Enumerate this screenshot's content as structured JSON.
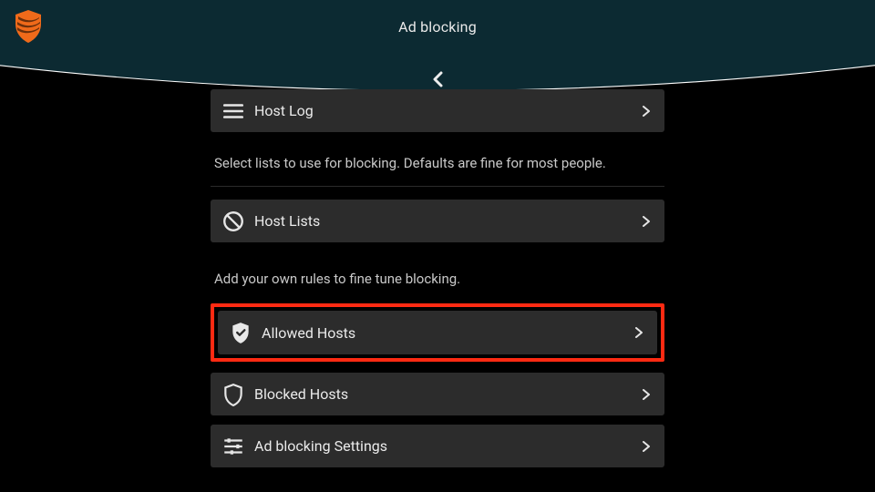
{
  "header": {
    "title": "Ad blocking"
  },
  "items": {
    "host_log": "Host Log",
    "host_lists": "Host Lists",
    "allowed_hosts": "Allowed Hosts",
    "blocked_hosts": "Blocked Hosts",
    "settings": "Ad blocking Settings"
  },
  "help": {
    "lists": "Select lists to use for blocking. Defaults are fine for most people.",
    "rules": "Add your own rules to fine tune blocking."
  },
  "colors": {
    "accent": "#f06a1a",
    "highlight": "#ff2a12",
    "topbar": "#0c2a32",
    "row": "#2c2c2c"
  }
}
